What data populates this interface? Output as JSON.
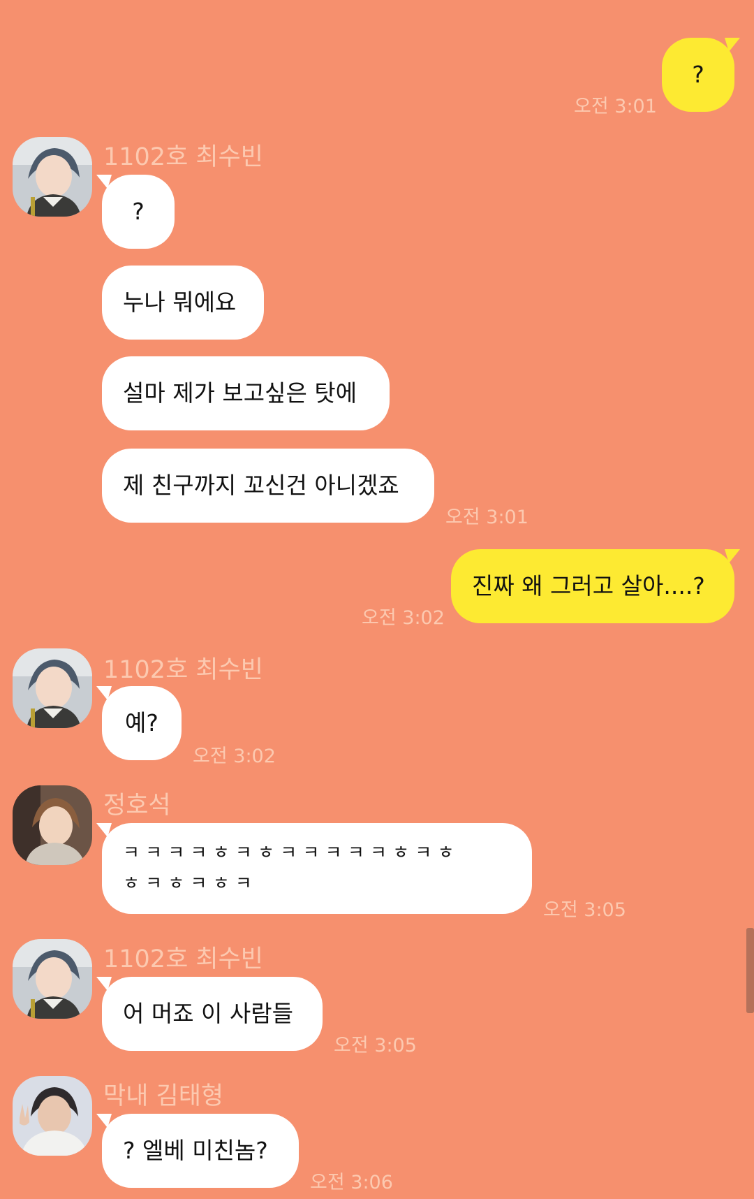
{
  "colors": {
    "background": "#F6906E",
    "incoming_bubble": "#FFFFFF",
    "outgoing_bubble": "#FDEA32",
    "meta_text": "#FCC9B0"
  },
  "messages": [
    {
      "dir": "out",
      "text": "?",
      "time": "오전 3:01"
    },
    {
      "dir": "in",
      "sender": "1102호 최수빈",
      "avatar": "avatar-soobin",
      "text": "?"
    },
    {
      "dir": "in",
      "text": "누나 뭐에요"
    },
    {
      "dir": "in",
      "text": "설마 제가 보고싶은 탓에"
    },
    {
      "dir": "in",
      "text": "제 친구까지 꼬신건 아니겠죠",
      "time": "오전 3:01"
    },
    {
      "dir": "out",
      "text": "진짜 왜 그러고 살아....?",
      "time": "오전 3:02"
    },
    {
      "dir": "in",
      "sender": "1102호 최수빈",
      "avatar": "avatar-soobin",
      "text": "예?",
      "time": "오전 3:02"
    },
    {
      "dir": "in",
      "sender": "정호석",
      "avatar": "avatar-hoseok",
      "text_lines": [
        "ㅋ ㅋ ㅋ ㅋ ㅎ ㅋ ㅎ ㅋ ㅋ ㅋ ㅋ ㅋ ㅎ ㅋ ㅎ",
        "ㅎ ㅋ ㅎ ㅋ ㅎ ㅋ"
      ],
      "time": "오전 3:05"
    },
    {
      "dir": "in",
      "sender": "1102호 최수빈",
      "avatar": "avatar-soobin",
      "text": "어 머죠 이 사람들",
      "time": "오전 3:05"
    },
    {
      "dir": "in",
      "sender": "막내 김태형",
      "avatar": "avatar-taehyung",
      "text": "? 엘베 미친놈?",
      "time": "오전 3:06"
    }
  ]
}
